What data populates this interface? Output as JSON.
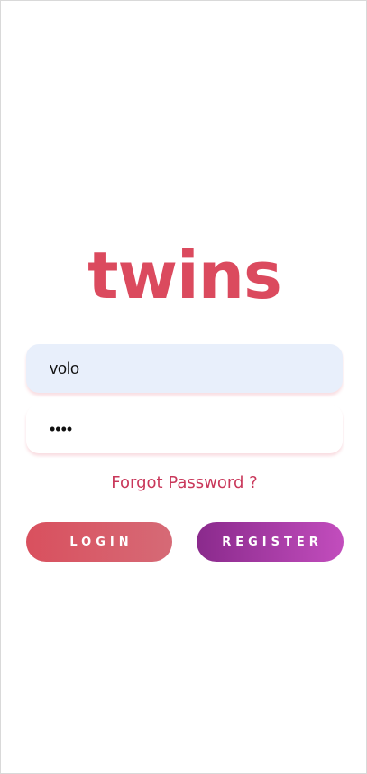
{
  "app": {
    "logo_text": "twins"
  },
  "form": {
    "username_value": "volo",
    "password_masked": "••••",
    "forgot_label": "Forgot Password ?"
  },
  "buttons": {
    "login_label": "LOGIN",
    "register_label": "REGISTER"
  },
  "colors": {
    "brand": "#db4a5e",
    "login_gradient_start": "#d9505e",
    "login_gradient_end": "#d66a76",
    "register_gradient_start": "#8a2a8c",
    "register_gradient_end": "#c24dbd",
    "username_field_bg": "#e8effb"
  }
}
